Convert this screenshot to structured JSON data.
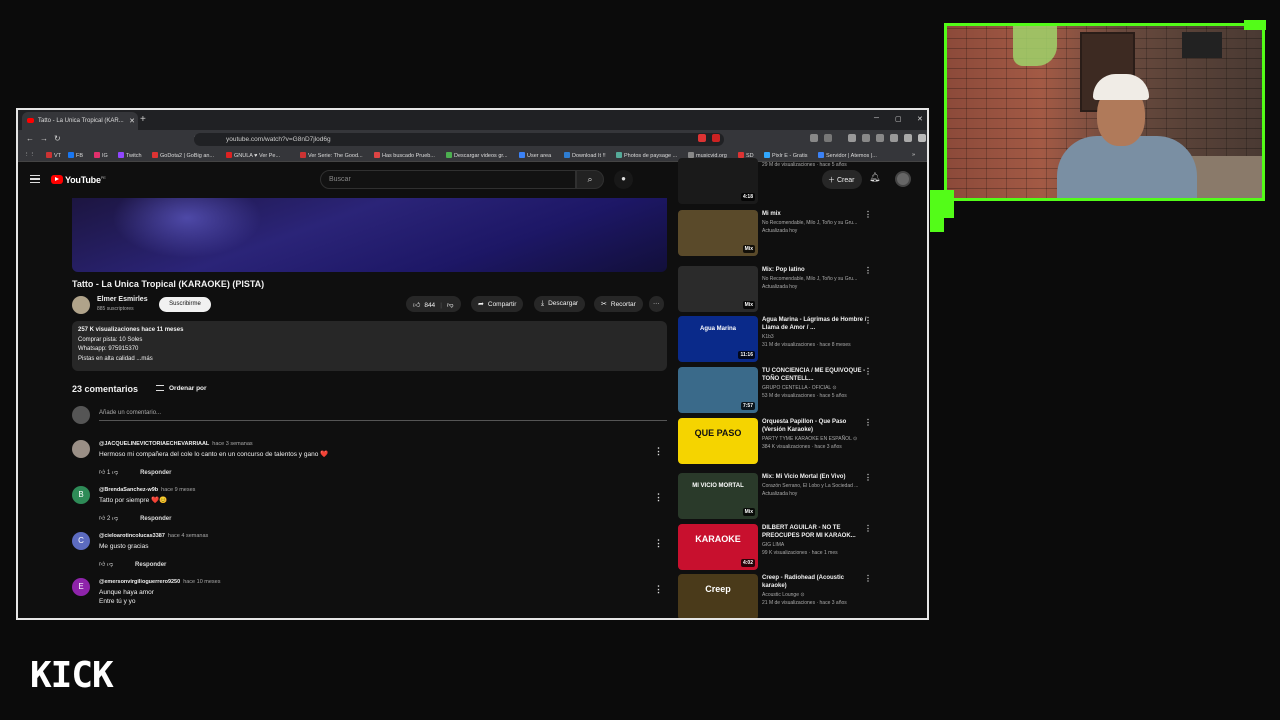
{
  "browser": {
    "tab_title": "Tatto - La Unica Tropical (KAR...",
    "url": "youtube.com/watch?v=G8nD7jlod6g",
    "bookmarks": [
      "VT",
      "FB",
      "IG",
      "Twitch",
      "GoDota2 | GoBig an...",
      "GNULA ♥ Ver Pe...",
      "Ver Serie: The Good...",
      "Has buscado Prueb...",
      "Descargar videos gr...",
      "User area",
      "Download It !!",
      "Photos de paysage ...",
      "musicvid.org",
      "SD",
      "Pixlr E - Gratis",
      "Servidor | Atemos |..."
    ]
  },
  "youtube": {
    "logo": "YouTube",
    "region": "PE",
    "search_placeholder": "Buscar",
    "create_label": "Crear",
    "video": {
      "title": "Tatto - La Unica Tropical (KARAOKE) (PISTA)",
      "channel": "Elmer Esmirles",
      "subscribers": "885 suscriptores",
      "subscribe_label": "Suscribirme",
      "likes": "844",
      "share_label": "Compartir",
      "download_label": "Descargar",
      "clip_label": "Recortar",
      "more_label": "···",
      "description": {
        "views_date": "257 K visualizaciones  hace 11 meses",
        "line2": "Comprar pista: 10 Soles",
        "line3": "Whatsapp: 975915370",
        "line4": "Pistas en alta calidad ...más"
      }
    },
    "comments": {
      "count_label": "23 comentarios",
      "sort_label": "Ordenar por",
      "add_placeholder": "Añade un comentario...",
      "reply_label": "Responder",
      "items": [
        {
          "user": "@JACQUELINEVICTORIAECHEVARRIAAL",
          "time": "hace 3 semanas",
          "text": "Hermoso mi compañera del cole lo canto en un concurso de talentos y gano ❤️",
          "likes": "1",
          "initial": "",
          "color": "#9a8f86"
        },
        {
          "user": "@BrendaSanchez-w9b",
          "time": "hace 9 meses",
          "text": "Tatto por siempre ❤️😊",
          "likes": "2",
          "initial": "B",
          "color": "#2e8b57"
        },
        {
          "user": "@cieloarotincolucas3387",
          "time": "hace 4 semanas",
          "text": "Me gusto gracias",
          "likes": "",
          "initial": "C",
          "color": "#5c6bc0"
        },
        {
          "user": "@emersonvirgilioguerrero9250",
          "time": "hace 10 meses",
          "text": "Aunque haya amor",
          "text2": "Entre tú y yo",
          "likes": "",
          "initial": "E",
          "color": "#8e24aa"
        }
      ]
    },
    "recommendations": [
      {
        "title": "",
        "meta1": "29 M de visualizaciones · hace 5 años",
        "meta2": "",
        "duration": "4:18",
        "thumb_bg": "#1a1a1a"
      },
      {
        "title": "Mi mix",
        "meta1": "No Recomendable, Milo J, Toño y su Gru...",
        "meta2": "Actualizada hoy",
        "duration": "Mix",
        "thumb_bg": "#5a4a2a"
      },
      {
        "title": "Mix: Pop latino",
        "meta1": "No Recomendable, Milo J, Toño y su Gru...",
        "meta2": "Actualizada hoy",
        "duration": "Mix",
        "thumb_bg": "#2b2b2b"
      },
      {
        "title": "Agua Marina - Lágrimas de Hombre / Llama de Amor / ...",
        "meta1": "K1b3",
        "meta2": "31 M de visualizaciones · hace 8 meses",
        "duration": "11:16",
        "thumb_bg": "#0a2a8a",
        "thumb_text": "Agua Marina"
      },
      {
        "title": "TU CONCIENCIA / ME EQUIVOQUE - TOÑO CENTELL...",
        "meta1": "GRUPO CENTELLA - OFICIAL ⊙",
        "meta2": "53 M de visualizaciones · hace 5 años",
        "duration": "7:57",
        "thumb_bg": "#3a6a8a"
      },
      {
        "title": "Orquesta Papillon - Que Paso (Versión Karaoke)",
        "meta1": "PARTY TYME KARAOKE EN ESPAÑOL ⊙",
        "meta2": "384 K visualizaciones · hace 3 años",
        "duration": "",
        "thumb_bg": "#f5d400",
        "thumb_text": "QUE PASO"
      },
      {
        "title": "Mix: Mi Vicio Mortal (En Vivo)",
        "meta1": "Corazón Serrano, El Lobo y La Sociedad ...",
        "meta2": "Actualizada hoy",
        "duration": "Mix",
        "thumb_bg": "#2a3a2a",
        "thumb_text": "MI VICIO MORTAL"
      },
      {
        "title": "DILBERT AGUILAR - NO TE PREOCUPES POR MI KARAOK...",
        "meta1": "GIG LIMA",
        "meta2": "99 K visualizaciones · hace 1 mes",
        "duration": "4:02",
        "thumb_bg": "#c8102e",
        "thumb_text": "KARAOKE"
      },
      {
        "title": "Creep - Radiohead (Acoustic karaoke)",
        "meta1": "Acoustic Lounge ⊙",
        "meta2": "21 M de visualizaciones · hace 3 años",
        "duration": "",
        "thumb_bg": "#4a3a1a",
        "thumb_text": "Creep"
      }
    ]
  },
  "stream": {
    "platform_logo": "KICK",
    "accent": "#53fc18"
  }
}
